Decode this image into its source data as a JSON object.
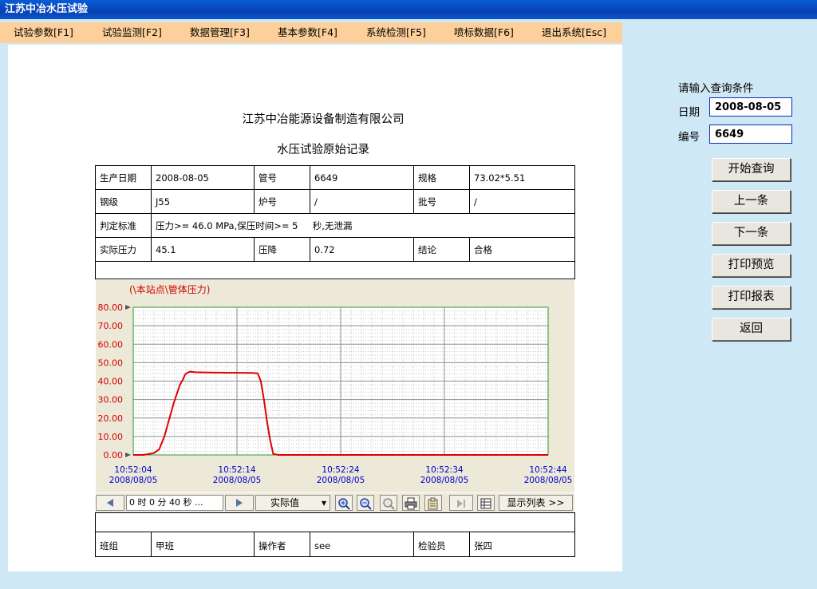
{
  "window": {
    "title": "江苏中冶水压试验"
  },
  "menu": [
    "试验参数[F1]",
    "试验监测[F2]",
    "数据管理[F3]",
    "基本参数[F4]",
    "系统检测[F5]",
    "喷标数据[F6]",
    "退出系统[Esc]"
  ],
  "report": {
    "company": "江苏中冶能源设备制造有限公司",
    "title": "水压试验原始记录",
    "row1": {
      "l1": "生产日期",
      "v1": "2008-08-05",
      "l2": "管号",
      "v2": "6649",
      "l3": "规格",
      "v3": "73.02*5.51"
    },
    "row2": {
      "l1": "钢级",
      "v1": "J55",
      "l2": "炉号",
      "v2": "/",
      "l3": "批号",
      "v3": "/"
    },
    "row3": {
      "l1": "判定标准",
      "v1": "压力>= 46.0 MPa,保压时间>= 5     秒,无泄漏"
    },
    "row4": {
      "l1": "实际压力",
      "v1": "45.1",
      "l2": "压降",
      "v2": "0.72",
      "l3": "结论",
      "v3": "合格"
    },
    "footer": {
      "l1": "班组",
      "v1": "甲班",
      "l2": "操作者",
      "v2": "see",
      "l3": "检验员",
      "v3": "张四"
    }
  },
  "chart_data": {
    "type": "line",
    "title": "(\\本站点\\管体压力)",
    "ylim": [
      0,
      80
    ],
    "yticks": [
      "80.00",
      "70.00",
      "60.00",
      "50.00",
      "40.00",
      "30.00",
      "20.00",
      "10.00",
      "0.00"
    ],
    "xticks": [
      {
        "time": "10:52:04",
        "date": "2008/08/05"
      },
      {
        "time": "10:52:14",
        "date": "2008/08/05"
      },
      {
        "time": "10:52:24",
        "date": "2008/08/05"
      },
      {
        "time": "10:52:34",
        "date": "2008/08/05"
      },
      {
        "time": "10:52:44",
        "date": "2008/08/05"
      }
    ],
    "xlim_seconds": [
      0,
      40
    ],
    "grid": true,
    "line_color": "#e00000",
    "axis_text_color": "#d40000",
    "time_text_color": "#0000c8",
    "series": [
      {
        "x": [
          0,
          1.0,
          2.0,
          2.5,
          3.0,
          3.3,
          3.6,
          3.9,
          4.2,
          4.5,
          4.8,
          5.0,
          5.2,
          5.5,
          6.0,
          8.0,
          10.0,
          11.5,
          12.0,
          12.3,
          12.6,
          12.9,
          13.2,
          13.5,
          14.0,
          20.0,
          30.0,
          40.0
        ],
        "y": [
          0,
          0,
          1,
          3,
          10,
          16,
          22,
          28,
          33,
          38,
          41,
          43.5,
          44.5,
          45.1,
          44.8,
          44.6,
          44.5,
          44.4,
          44.2,
          40,
          30,
          18,
          8,
          0.5,
          0,
          0,
          0,
          0
        ]
      }
    ]
  },
  "chart_toolbar": {
    "duration": "0 时 0 分 40 秒 ...",
    "mode": "实际值",
    "list_button": "显示列表 >>"
  },
  "query": {
    "prompt": "请输入查询条件",
    "date_label": "日期",
    "date_value": "2008-08-05",
    "no_label": "编号",
    "no_value": "6649",
    "buttons": [
      "开始查询",
      "上一条",
      "下一条",
      "打印预览",
      "打印报表",
      "返回"
    ]
  }
}
